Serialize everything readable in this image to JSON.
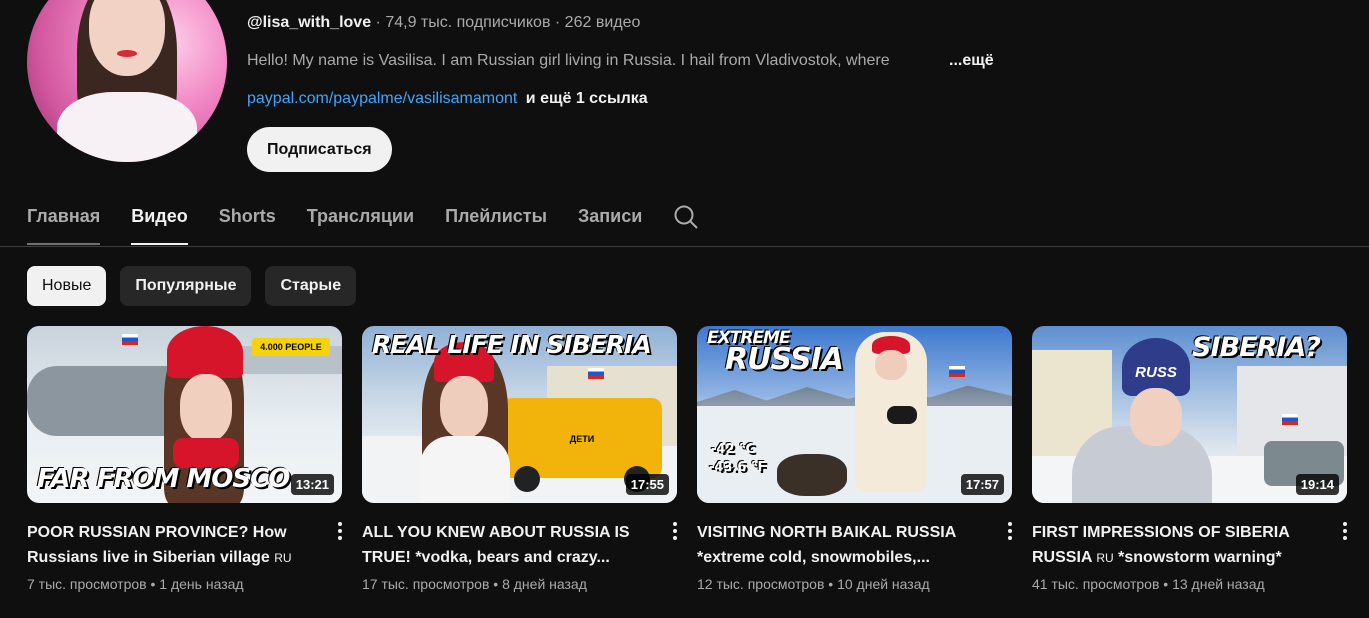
{
  "channel": {
    "handle": "@lisa_with_love",
    "subscribers": "· 74,9 тыс. подписчиков",
    "videos_count": "· 262 видео",
    "description": "Hello! My name is Vasilisa. I am Russian girl living in Russia. I hail from Vladivostok, where",
    "description_more": "...ещё",
    "link": "paypal.com/paypalme/vasilisamamont",
    "more_links": "и ещё 1 ссылка",
    "subscribe_label": "Подписаться"
  },
  "tabs": [
    {
      "label": "Главная"
    },
    {
      "label": "Видео"
    },
    {
      "label": "Shorts"
    },
    {
      "label": "Трансляции"
    },
    {
      "label": "Плейлисты"
    },
    {
      "label": "Записи"
    }
  ],
  "chips": [
    {
      "label": "Новые"
    },
    {
      "label": "Популярные"
    },
    {
      "label": "Старые"
    }
  ],
  "videos": [
    {
      "thumb_text": "FAR FROM MOSCO",
      "thumb_badge": "4.000 PEOPLE",
      "duration": "13:21",
      "title": "POOR RUSSIAN PROVINCE? How Russians live in Siberian village",
      "title_tag": "RU",
      "stats": "7 тыс. просмотров • 1 день назад"
    },
    {
      "thumb_text": "REAL LIFE IN SIBERIA",
      "thumb_badge": "ДЕТИ",
      "duration": "17:55",
      "title": "ALL YOU KNEW ABOUT RUSSIA IS TRUE! *vodka, bears and crazy...",
      "title_tag": "",
      "stats": "17 тыс. просмотров • 8 дней назад"
    },
    {
      "thumb_text_1": "EXTREME",
      "thumb_text_2": "RUSSIA",
      "thumb_temp_c": "-42 °C",
      "thumb_temp_f": "-43.6 °F",
      "duration": "17:57",
      "title": "VISITING NORTH BAIKAL RUSSIA *extreme cold, snowmobiles,...",
      "title_tag": "",
      "stats": "12 тыс. просмотров • 10 дней назад"
    },
    {
      "thumb_text": "SIBERIA?",
      "thumb_hat_text": "RUSS",
      "duration": "19:14",
      "title": "FIRST IMPRESSIONS OF SIBERIA RUSSIA",
      "title_tag": "RU",
      "title_suffix": "*snowstorm warning*",
      "stats": "41 тыс. просмотров • 13 дней назад"
    }
  ]
}
